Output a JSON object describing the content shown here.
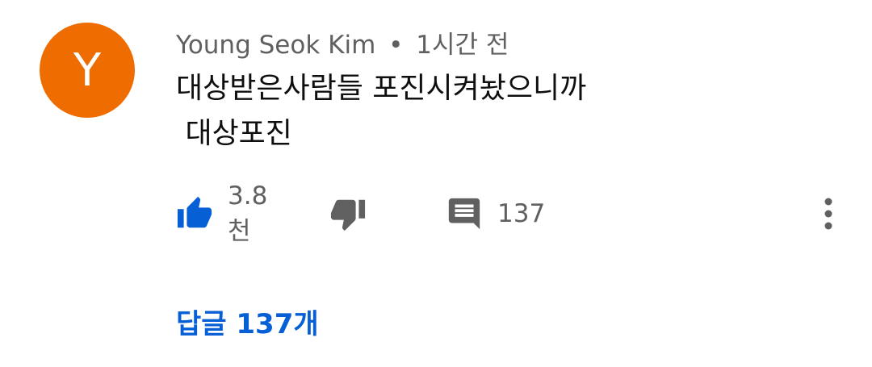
{
  "comment": {
    "avatar_letter": "Y",
    "avatar_color": "#ef6c00",
    "author": "Young Seok Kim",
    "separator": "•",
    "time": "1시간 전",
    "text_line1": "대상받은사람들 포진시켜놨으니까",
    "text_line2": " 대상포진"
  },
  "actions": {
    "like_icon": "thumb-up-filled-icon",
    "like_count": "3.8천",
    "dislike_icon": "thumb-down-icon",
    "reply_icon": "comment-icon",
    "reply_count": "137",
    "more_icon": "vertical-dots-icon",
    "accent_color": "#065fd4"
  },
  "replies": {
    "label": "답글 137개"
  }
}
